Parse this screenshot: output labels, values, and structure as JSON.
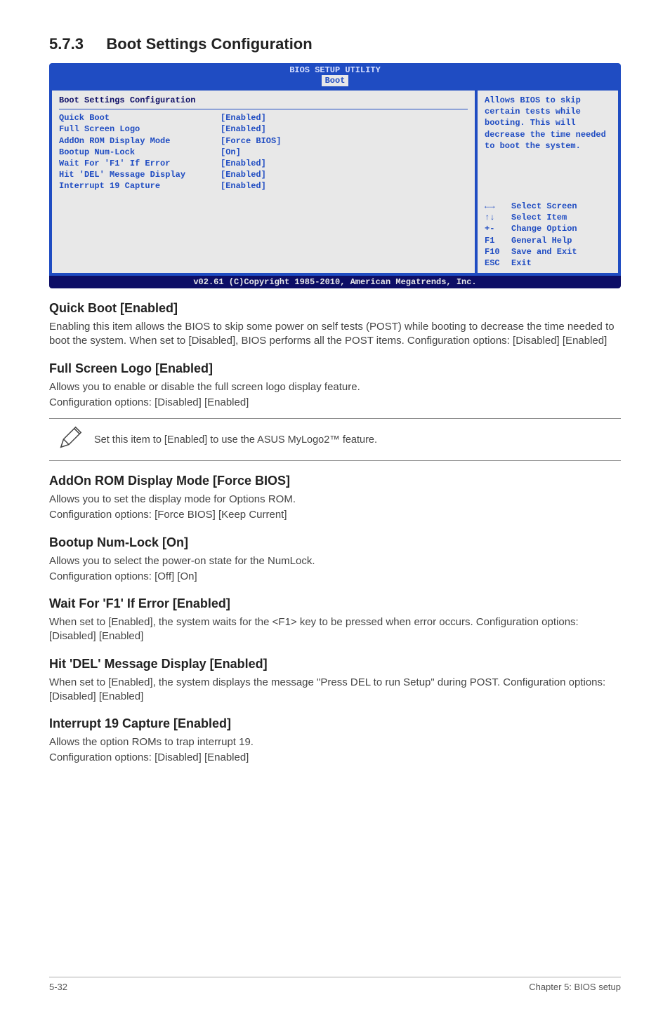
{
  "section": {
    "number": "5.7.3",
    "title": "Boot Settings Configuration"
  },
  "bios": {
    "header": "BIOS SETUP UTILITY",
    "active_tab": "Boot",
    "panel_title": "Boot Settings Configuration",
    "rows": [
      {
        "label": "Quick Boot",
        "value": "[Enabled]"
      },
      {
        "label": "Full Screen Logo",
        "value": "[Enabled]"
      },
      {
        "label": "AddOn ROM Display Mode",
        "value": "[Force BIOS]"
      },
      {
        "label": "Bootup Num-Lock",
        "value": "[On]"
      },
      {
        "label": "Wait For 'F1' If Error",
        "value": "[Enabled]"
      },
      {
        "label": "Hit 'DEL' Message Display",
        "value": "[Enabled]"
      },
      {
        "label": "Interrupt 19 Capture",
        "value": "[Enabled]"
      }
    ],
    "help_text": "Allows BIOS to skip certain tests while booting. This will decrease the time needed to boot the system.",
    "nav": [
      {
        "key": "←→",
        "action": "Select Screen"
      },
      {
        "key": "↑↓",
        "action": "Select Item"
      },
      {
        "key": "+-",
        "action": "Change Option"
      },
      {
        "key": "F1",
        "action": "General Help"
      },
      {
        "key": "F10",
        "action": "Save and Exit"
      },
      {
        "key": "ESC",
        "action": "Exit"
      }
    ],
    "footer": "v02.61 (C)Copyright 1985-2010, American Megatrends, Inc."
  },
  "subs": {
    "quick_boot": {
      "heading": "Quick Boot [Enabled]",
      "body": "Enabling this item allows the BIOS to skip some power on self tests (POST) while booting to decrease the time needed to boot the system. When set to [Disabled], BIOS performs all the POST items. Configuration options: [Disabled] [Enabled]"
    },
    "full_screen_logo": {
      "heading": "Full Screen Logo [Enabled]",
      "body1": "Allows you to enable or disable the full screen logo display feature.",
      "body2": "Configuration options: [Disabled] [Enabled]"
    },
    "note": "Set this item to [Enabled] to use the ASUS MyLogo2™ feature.",
    "addon_rom": {
      "heading": "AddOn ROM Display Mode [Force BIOS]",
      "body1": "Allows you to set the display mode for Options ROM.",
      "body2": "Configuration options: [Force BIOS] [Keep Current]"
    },
    "bootup_numlock": {
      "heading": "Bootup Num-Lock [On]",
      "body1": "Allows you to select the power-on state for the NumLock.",
      "body2": "Configuration options: [Off] [On]"
    },
    "wait_f1": {
      "heading": "Wait For 'F1' If Error [Enabled]",
      "body": "When set to [Enabled], the system waits for the <F1> key to be pressed when error occurs. Configuration options: [Disabled] [Enabled]"
    },
    "hit_del": {
      "heading": "Hit 'DEL' Message Display [Enabled]",
      "body": "When set to [Enabled], the system displays the message \"Press DEL to run Setup\" during POST. Configuration options: [Disabled] [Enabled]"
    },
    "int19": {
      "heading": "Interrupt 19 Capture [Enabled]",
      "body1": "Allows the option ROMs to trap interrupt 19.",
      "body2": "Configuration options: [Disabled] [Enabled]"
    }
  },
  "footer": {
    "left": "5-32",
    "right": "Chapter 5: BIOS setup"
  }
}
